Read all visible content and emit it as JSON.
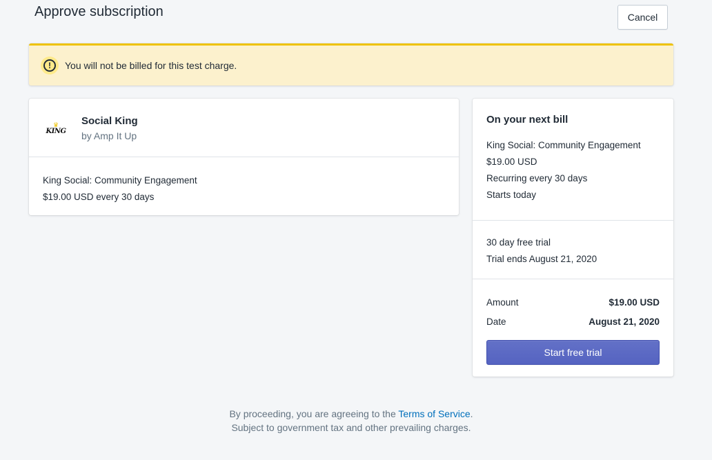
{
  "header": {
    "title": "Approve subscription",
    "cancel_label": "Cancel"
  },
  "banner": {
    "icon": "alert-circle-icon",
    "message": "You will not be billed for this test charge.",
    "colors": {
      "background": "#fcf1cd",
      "border": "#eec200"
    }
  },
  "app": {
    "name": "Social King",
    "developer": "by Amp It Up",
    "logo_text": "KING",
    "plan_name": "King Social: Community Engagement",
    "plan_price": "$19.00 USD every 30 days"
  },
  "bill": {
    "heading": "On your next bill",
    "plan_name": "King Social: Community Engagement",
    "price": "$19.00 USD",
    "recurring": "Recurring every 30 days",
    "starts": "Starts today",
    "trial": "30 day free trial",
    "trial_ends": "Trial ends August 21, 2020",
    "amount_label": "Amount",
    "amount_value": "$19.00 USD",
    "date_label": "Date",
    "date_value": "August 21, 2020",
    "cta_label": "Start free trial",
    "cta_color": "#5c6ac4"
  },
  "footer": {
    "prefix": "By proceeding, you are agreeing to the ",
    "link_text": "Terms of Service",
    "suffix": ".",
    "line2": "Subject to government tax and other prevailing charges."
  }
}
